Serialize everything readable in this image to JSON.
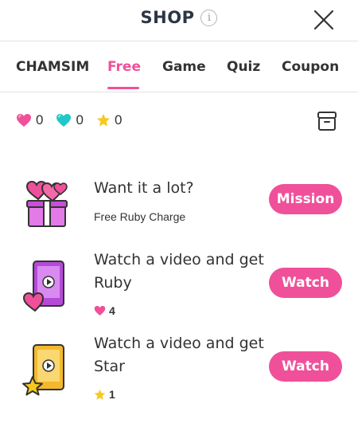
{
  "header": {
    "title": "SHOP",
    "info_icon": "info-icon",
    "close_icon": "close-icon"
  },
  "tabs": [
    {
      "label": "CHAMSIM",
      "active": false
    },
    {
      "label": "Free",
      "active": true
    },
    {
      "label": "Game",
      "active": false
    },
    {
      "label": "Quiz",
      "active": false
    },
    {
      "label": "Coupon",
      "active": false
    }
  ],
  "balance": {
    "pink_ruby": "0",
    "blue_ruby": "0",
    "star": "0",
    "storage_icon": "archive-box-icon"
  },
  "offers": [
    {
      "title": "Want it a lot?",
      "subtitle": "Free Ruby Charge",
      "button": "Mission",
      "icon": "gift-box-hearts-icon"
    },
    {
      "title_line1": "Watch a video and get",
      "title_line2": "Ruby",
      "reward_value": "4",
      "reward_icon": "heart-icon",
      "button": "Watch",
      "icon": "video-phone-heart-icon"
    },
    {
      "title_line1": "Watch a video and get",
      "title_line2": "Star",
      "reward_value": "1",
      "reward_icon": "star-icon",
      "button": "Watch",
      "icon": "video-phone-star-icon"
    }
  ],
  "colors": {
    "accent": "#f0509a",
    "title": "#2b3645",
    "blue_ruby": "#22c7c9",
    "star": "#f7c81e"
  }
}
